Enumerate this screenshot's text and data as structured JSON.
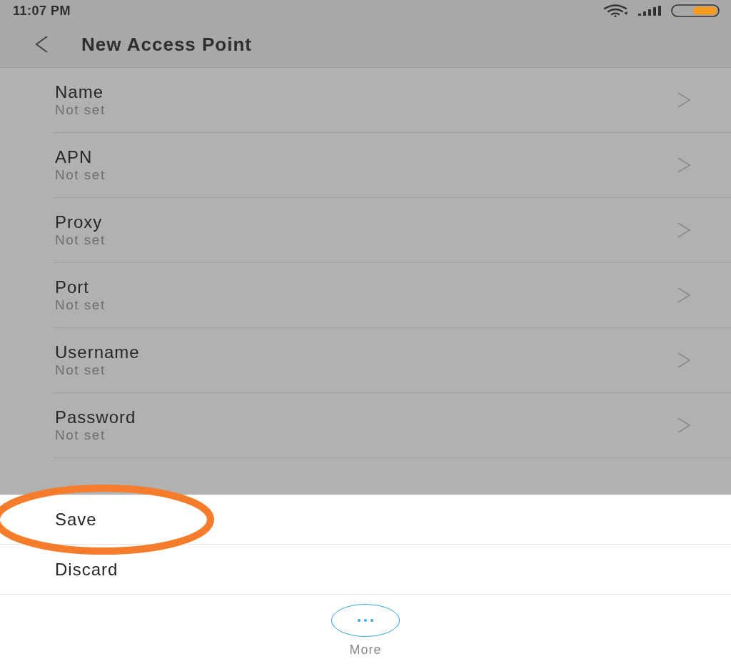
{
  "status_bar": {
    "time": "11:07 PM"
  },
  "toolbar": {
    "title": "New Access Point"
  },
  "fields": [
    {
      "label": "Name",
      "value": "Not set"
    },
    {
      "label": "APN",
      "value": "Not set"
    },
    {
      "label": "Proxy",
      "value": "Not set"
    },
    {
      "label": "Port",
      "value": "Not set"
    },
    {
      "label": "Username",
      "value": "Not set"
    },
    {
      "label": "Password",
      "value": "Not set"
    }
  ],
  "menu": {
    "items": [
      {
        "label": "Save",
        "highlighted": true
      },
      {
        "label": "Discard",
        "highlighted": false
      }
    ]
  },
  "more_button": {
    "label": "More"
  }
}
